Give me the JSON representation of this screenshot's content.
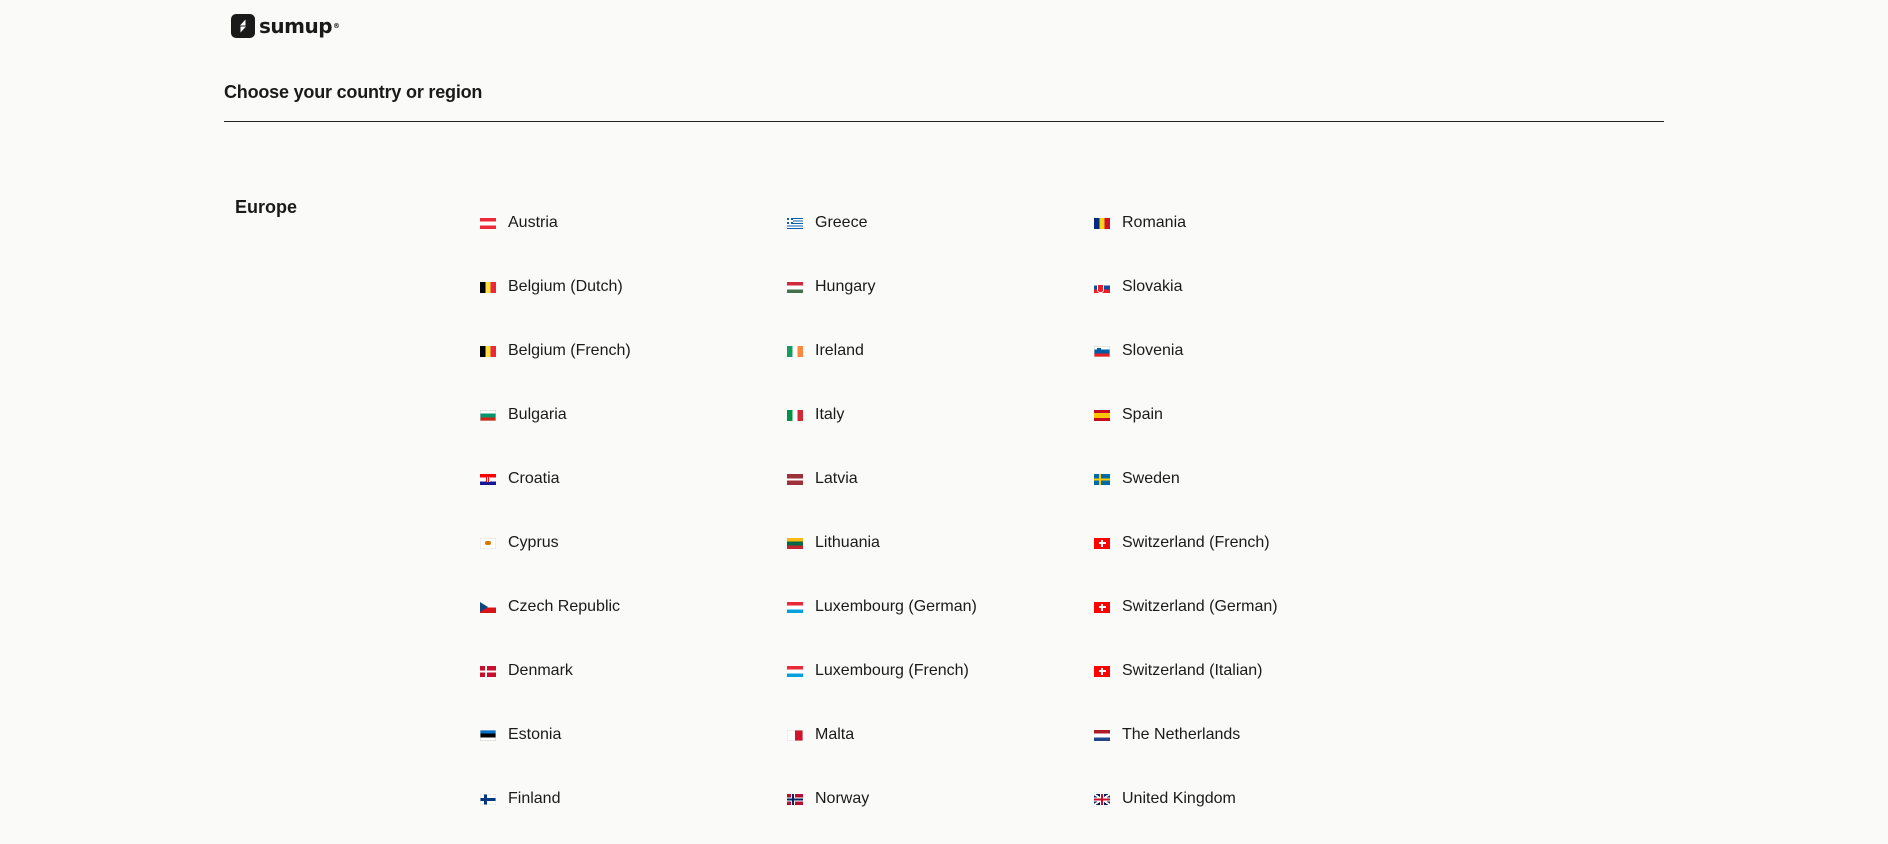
{
  "brand": {
    "name": "sumup",
    "reg": "®"
  },
  "page": {
    "title": "Choose your country or region"
  },
  "regions": [
    {
      "name": "Europe",
      "countries": [
        {
          "label": "Austria",
          "flag": "flag-austria-icon",
          "code": "at"
        },
        {
          "label": "Belgium (Dutch)",
          "flag": "flag-belgium-icon",
          "code": "be"
        },
        {
          "label": "Belgium (French)",
          "flag": "flag-belgium-icon",
          "code": "be"
        },
        {
          "label": "Bulgaria",
          "flag": "flag-bulgaria-icon",
          "code": "bg"
        },
        {
          "label": "Croatia",
          "flag": "flag-croatia-icon",
          "code": "hr"
        },
        {
          "label": "Cyprus",
          "flag": "flag-cyprus-icon",
          "code": "cy"
        },
        {
          "label": "Czech Republic",
          "flag": "flag-czech-republic-icon",
          "code": "cz"
        },
        {
          "label": "Denmark",
          "flag": "flag-denmark-icon",
          "code": "dk"
        },
        {
          "label": "Estonia",
          "flag": "flag-estonia-icon",
          "code": "ee"
        },
        {
          "label": "Finland",
          "flag": "flag-finland-icon",
          "code": "fi"
        },
        {
          "label": "Greece",
          "flag": "flag-greece-icon",
          "code": "gr"
        },
        {
          "label": "Hungary",
          "flag": "flag-hungary-icon",
          "code": "hu"
        },
        {
          "label": "Ireland",
          "flag": "flag-ireland-icon",
          "code": "ie"
        },
        {
          "label": "Italy",
          "flag": "flag-italy-icon",
          "code": "it"
        },
        {
          "label": "Latvia",
          "flag": "flag-latvia-icon",
          "code": "lv"
        },
        {
          "label": "Lithuania",
          "flag": "flag-lithuania-icon",
          "code": "lt"
        },
        {
          "label": "Luxembourg (German)",
          "flag": "flag-luxembourg-icon",
          "code": "lu"
        },
        {
          "label": "Luxembourg (French)",
          "flag": "flag-luxembourg-icon",
          "code": "lu"
        },
        {
          "label": "Malta",
          "flag": "flag-malta-icon",
          "code": "mt"
        },
        {
          "label": "Norway",
          "flag": "flag-norway-icon",
          "code": "no"
        },
        {
          "label": "Romania",
          "flag": "flag-romania-icon",
          "code": "ro"
        },
        {
          "label": "Slovakia",
          "flag": "flag-slovakia-icon",
          "code": "sk"
        },
        {
          "label": "Slovenia",
          "flag": "flag-slovenia-icon",
          "code": "si"
        },
        {
          "label": "Spain",
          "flag": "flag-spain-icon",
          "code": "es"
        },
        {
          "label": "Sweden",
          "flag": "flag-sweden-icon",
          "code": "se"
        },
        {
          "label": "Switzerland (French)",
          "flag": "flag-switzerland-icon",
          "code": "ch"
        },
        {
          "label": "Switzerland (German)",
          "flag": "flag-switzerland-icon",
          "code": "ch"
        },
        {
          "label": "Switzerland (Italian)",
          "flag": "flag-switzerland-icon",
          "code": "ch"
        },
        {
          "label": "The Netherlands",
          "flag": "flag-netherlands-icon",
          "code": "nl"
        },
        {
          "label": "United Kingdom",
          "flag": "flag-united-kingdom-icon",
          "code": "gb"
        }
      ]
    }
  ]
}
